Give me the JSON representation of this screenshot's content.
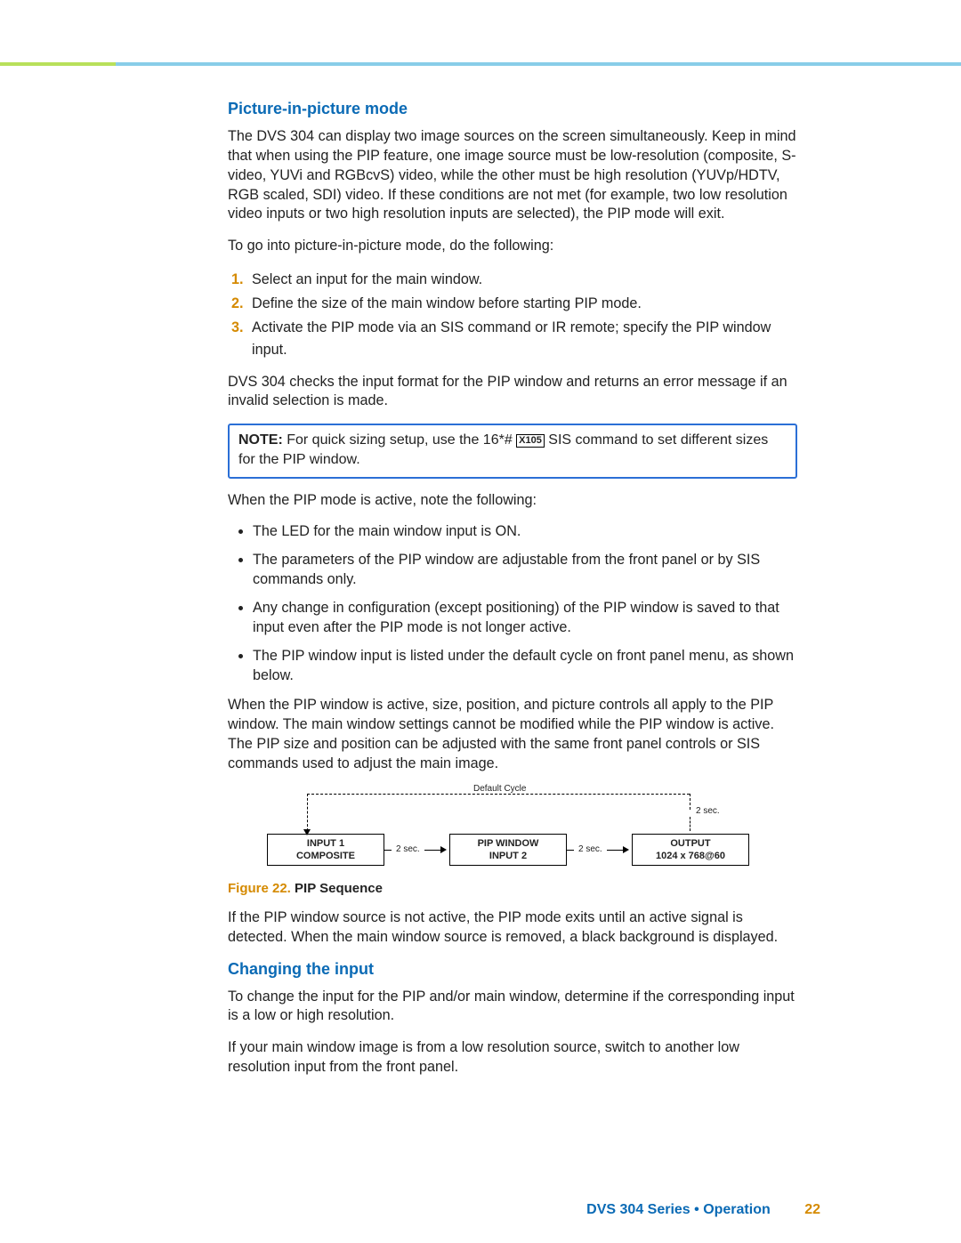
{
  "heading1": "Picture-in-picture mode",
  "p1": "The DVS 304 can display two image sources on the screen simultaneously. Keep in mind that when using the PIP feature, one image source must be low-resolution (composite, S-video, YUVi and RGBcvS) video, while the other must be high resolution (YUVp/HDTV, RGB scaled, SDI) video. If these conditions are not met (for example, two low resolution video inputs or two high resolution inputs are selected), the PIP mode will exit.",
  "p2": "To go into picture-in-picture mode, do the following:",
  "ol": [
    "Select an input for the main window.",
    "Define the size of the main window before starting PIP mode.",
    "Activate the PIP mode via an SIS command or IR remote; specify the PIP window input."
  ],
  "p3": "DVS 304 checks the input format for the PIP window and returns an error message if an invalid selection is made.",
  "note_label": "NOTE:",
  "note_pre": "For quick sizing setup, use the 16*# ",
  "note_x105": "X105",
  "note_post": " SIS command to set different sizes for the PIP window.",
  "p4": "When the PIP mode is active, note the following:",
  "ul": [
    "The LED for the main window input is ON.",
    "The parameters of the PIP window are adjustable from the front panel or by SIS commands only.",
    "Any change in configuration (except positioning) of the PIP window is saved to that input even after the PIP mode is not longer active.",
    "The PIP window input is listed under the default cycle on front panel menu, as shown below."
  ],
  "p5": "When the PIP window is active, size, position, and picture controls all apply to the PIP window. The main window settings cannot be modified while the PIP window is active. The PIP size and position can be adjusted with the same front panel controls or SIS commands used to adjust the main image.",
  "diagram": {
    "default_cycle": "Default Cycle",
    "box1_l1": "INPUT 1",
    "box1_l2": "COMPOSITE",
    "box2_l1": "PIP WINDOW",
    "box2_l2": "INPUT 2",
    "box3_l1": "OUTPUT",
    "box3_l2": "1024 x 768@60",
    "t2sec": "2 sec.",
    "t2sec2": "2 sec.",
    "t2sec3": "2 sec."
  },
  "fig_label": "Figure 22.",
  "fig_title": " PIP Sequence",
  "p6": "If the PIP window source is not active, the PIP mode exits until an active signal is detected. When the main window source is removed, a black background is displayed.",
  "heading2": "Changing the input",
  "p7": "To change the input for the PIP and/or main window, determine if the corresponding input is a low or high resolution.",
  "p8": "If your main window image is from a low resolution source, switch to another low resolution input from the front panel.",
  "footer_text": "DVS 304 Series • Operation",
  "page_number": "22"
}
